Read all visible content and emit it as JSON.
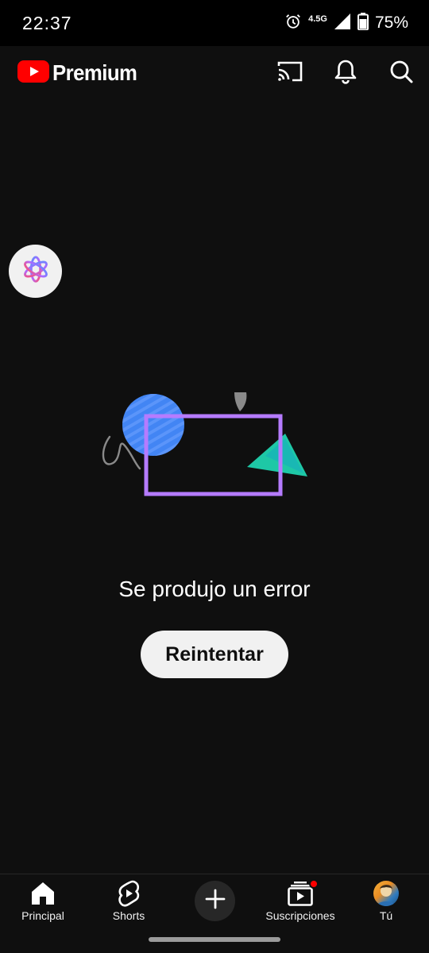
{
  "status_bar": {
    "time": "22:37",
    "network": "4.5G",
    "battery": "75%"
  },
  "header": {
    "brand": "Premium",
    "icons": [
      "cast-icon",
      "bell-icon",
      "search-icon"
    ]
  },
  "content": {
    "error_message": "Se produjo un error",
    "retry_label": "Reintentar"
  },
  "nav": {
    "items": [
      {
        "label": "Principal",
        "icon": "home-icon"
      },
      {
        "label": "Shorts",
        "icon": "shorts-icon"
      },
      {
        "label": "",
        "icon": "create-icon"
      },
      {
        "label": "Suscripciones",
        "icon": "subscriptions-icon"
      },
      {
        "label": "Tú",
        "icon": "avatar"
      }
    ]
  },
  "colors": {
    "background": "#0f0f0f",
    "brand_red": "#ff0000",
    "illustration_blue": "#4285f4",
    "illustration_purple": "#b57bff",
    "illustration_teal": "#1ec8a6"
  }
}
